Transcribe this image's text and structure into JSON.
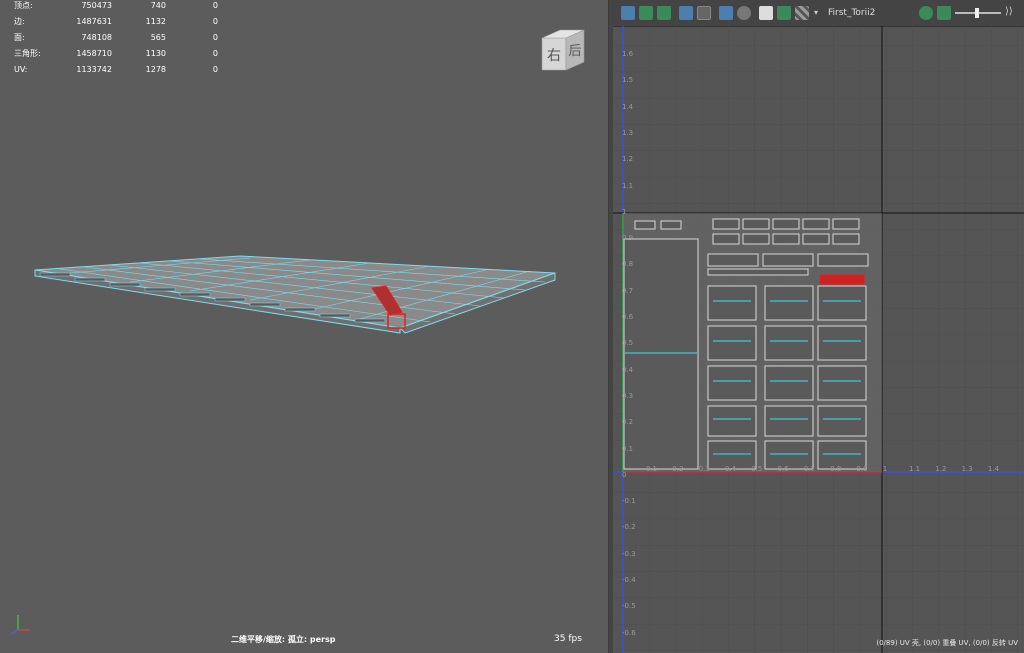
{
  "hud": {
    "rows": [
      {
        "label": "顶点:",
        "v1": "750473",
        "v2": "740",
        "v3": "0"
      },
      {
        "label": "边:",
        "v1": "1487631",
        "v2": "1132",
        "v3": "0"
      },
      {
        "label": "面:",
        "v1": "748108",
        "v2": "565",
        "v3": "0"
      },
      {
        "label": "三角形:",
        "v1": "1458710",
        "v2": "1130",
        "v3": "0"
      },
      {
        "label": "UV:",
        "v1": "1133742",
        "v2": "1278",
        "v3": "0"
      }
    ]
  },
  "viewcube": {
    "face_right": "右",
    "face_back": "后"
  },
  "viewport": {
    "status": "二维平移/缩放: 孤立: persp",
    "fps": "35 fps"
  },
  "uv_editor": {
    "uv_set_name": "First_Torii2",
    "y_ticks": [
      "1.6",
      "1.5",
      "1.4",
      "1.3",
      "1.2",
      "1.1",
      "1",
      "0.9",
      "0.8",
      "0.7",
      "0.6",
      "0.5",
      "0.4",
      "0.3",
      "0.2",
      "0.1",
      "0",
      "-0.1",
      "-0.2",
      "-0.3",
      "-0.4",
      "-0.5",
      "-0.6"
    ],
    "x_ticks": [
      "0.1",
      "0.2",
      "0.3",
      "0.4",
      "0.5",
      "0.6",
      "0.7",
      "0.8",
      "0.9",
      "1",
      "1.1",
      "1.2",
      "1.3",
      "1.4"
    ],
    "status": "(0/89) UV 壳, (0/0) 重叠 UV, (0/0) 反转 UV",
    "toolbar_icons": [
      "uv-toggle-icon",
      "checker-icon",
      "wireframe-icon",
      "shaded-icon",
      "grid-icon",
      "snap-icon",
      "screenshot-icon",
      "image-icon",
      "texture-icon",
      "dropdown-icon",
      "color-icon",
      "exposure-icon",
      "gamma-icon"
    ]
  },
  "colors": {
    "viewport_bg": "#5c5c5c",
    "uv_bg": "#555555",
    "wire": "#7fdcf0",
    "selection": "#e02020",
    "uv_shell": "#d8d8d8"
  }
}
